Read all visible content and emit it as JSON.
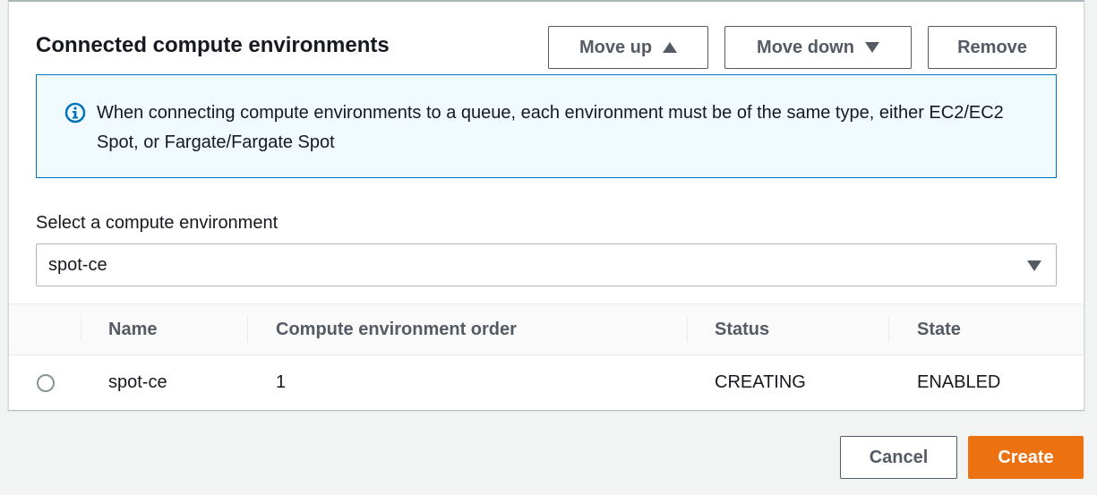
{
  "panel": {
    "title": "Connected compute environments",
    "buttons": {
      "move_up": "Move up",
      "move_down": "Move down",
      "remove": "Remove"
    },
    "info": {
      "icon": "info-icon",
      "text": "When connecting compute environments to a queue, each environment must be of the same type, either EC2/EC2 Spot, or Fargate/Fargate Spot"
    },
    "select": {
      "label": "Select a compute environment",
      "value": "spot-ce"
    },
    "table": {
      "columns": [
        "Name",
        "Compute environment order",
        "Status",
        "State"
      ],
      "rows": [
        {
          "name": "spot-ce",
          "order": "1",
          "status": "CREATING",
          "state": "ENABLED",
          "selected": false
        }
      ]
    }
  },
  "footer": {
    "cancel": "Cancel",
    "create": "Create"
  },
  "colors": {
    "primary": "#ec7211",
    "info_border": "#0073bb",
    "info_background": "#f1faff",
    "page_background": "#f2f3f3"
  }
}
